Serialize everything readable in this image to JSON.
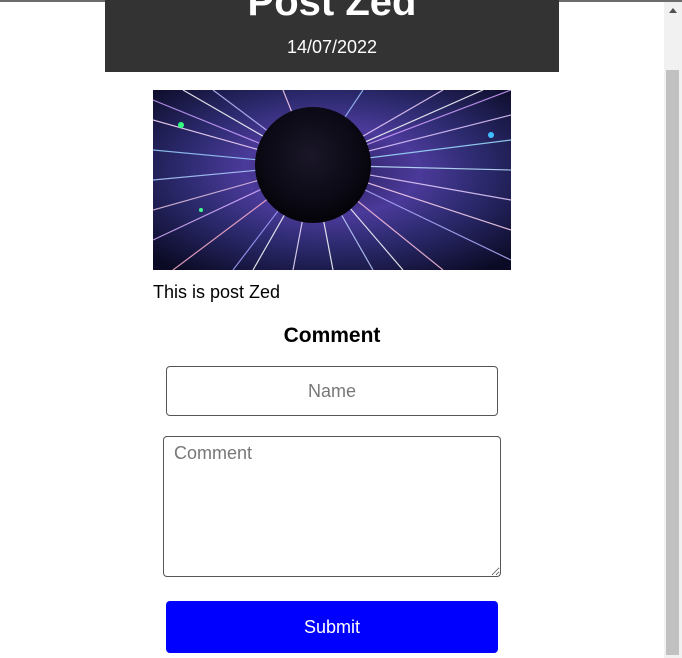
{
  "post": {
    "title": "Post Zed",
    "date": "14/07/2022",
    "image_alt": "Black sphere surrounded by radiating colorful light streaks",
    "body": "This is post Zed"
  },
  "comment_form": {
    "heading": "Comment",
    "name_placeholder": "Name",
    "comment_placeholder": "Comment",
    "submit_label": "Submit"
  },
  "colors": {
    "header_bg": "#333333",
    "submit_bg": "#0000ff"
  }
}
